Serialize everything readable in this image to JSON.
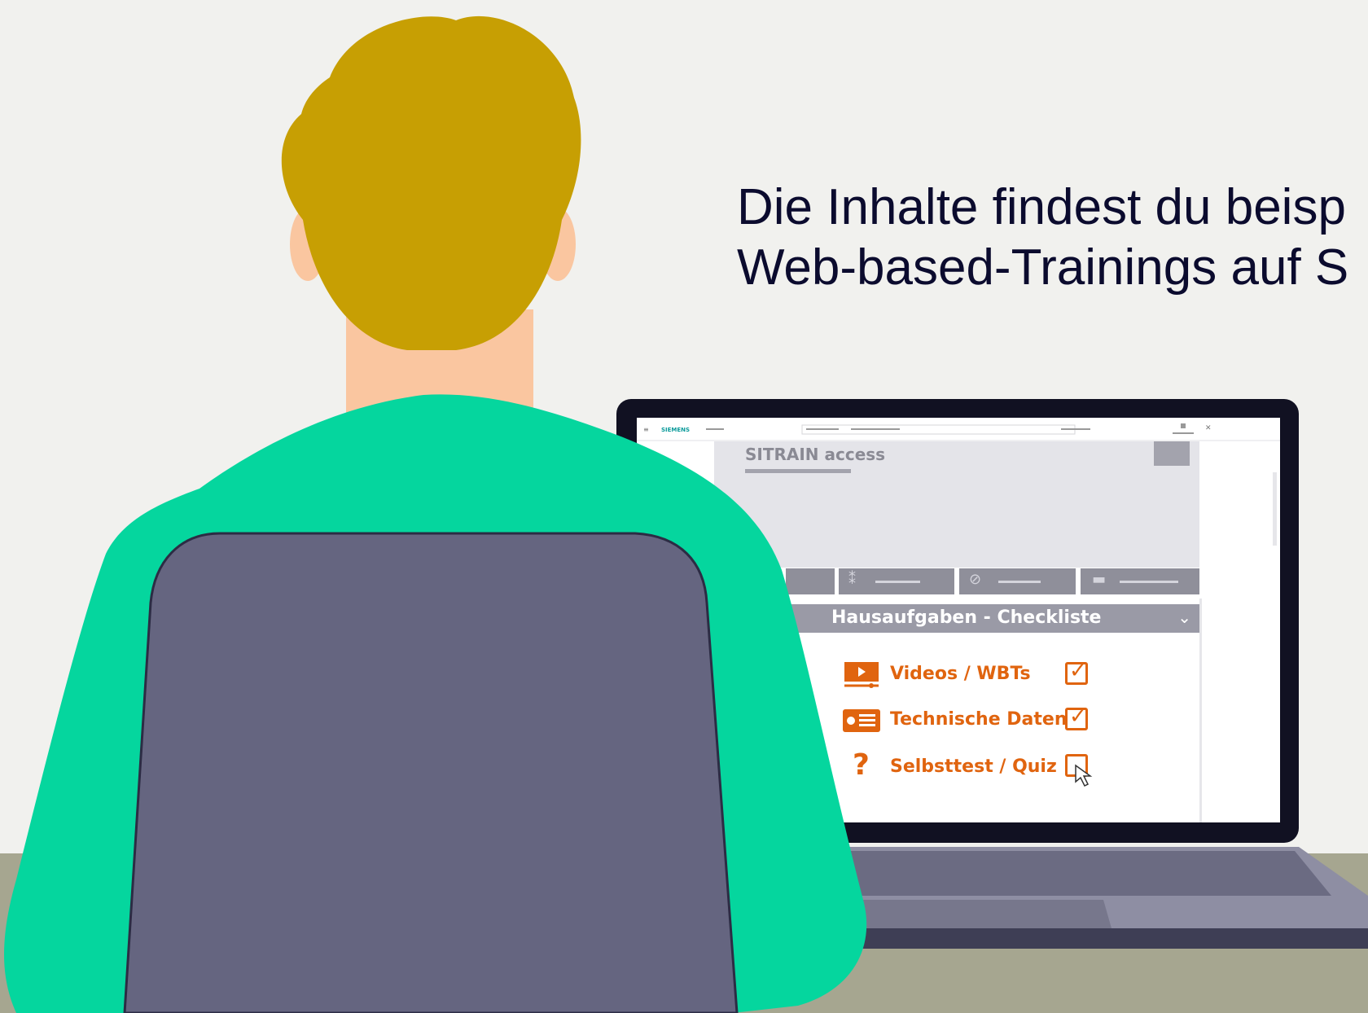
{
  "caption": {
    "line1": "Die Inhalte findest du beisp",
    "line2": "Web-based-Trainings auf S"
  },
  "screen": {
    "topbar_brand": "SIEMENS",
    "title": "SITRAIN access",
    "checklist": {
      "header": "Hausaufgaben - Checkliste",
      "items": [
        {
          "label": "Videos / WBTs",
          "icon": "video-icon",
          "checked": true
        },
        {
          "label": "Technische Daten",
          "icon": "data-sheet-icon",
          "checked": true
        },
        {
          "label": "Selbsttest / Quiz",
          "icon": "question-mark-icon",
          "checked": false
        }
      ]
    }
  },
  "colors": {
    "background": "#f1f1ee",
    "hair": "#c79f03",
    "skin": "#fac6a0",
    "shirt": "#05d69e",
    "chair": "#656580",
    "desk": "#a6a690",
    "laptop_frame": "#111122",
    "accent_orange": "#e0640f",
    "caption_text": "#0b0b2e"
  }
}
